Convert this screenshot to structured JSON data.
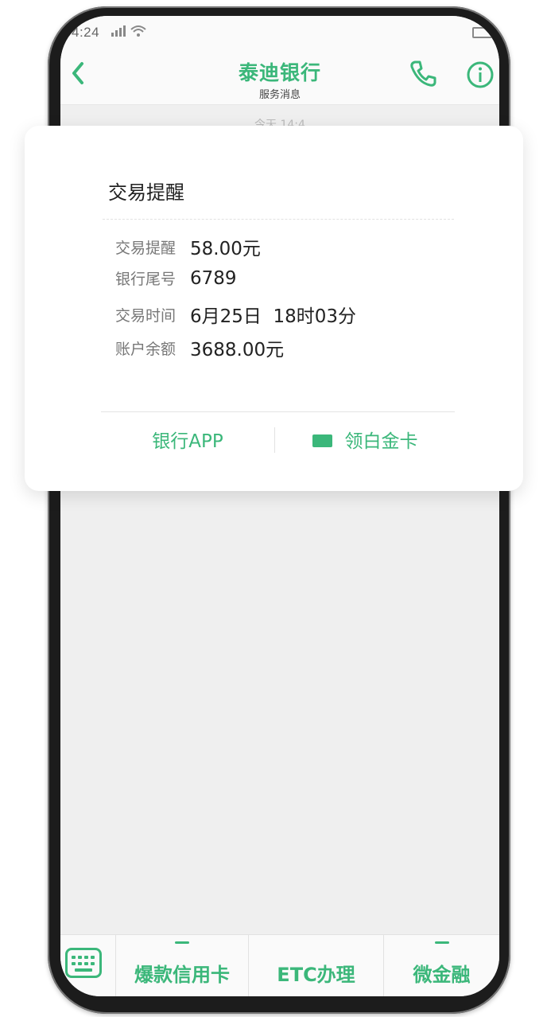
{
  "status_bar": {
    "time": "4:24"
  },
  "nav": {
    "title": "泰迪银行",
    "subtitle": "服务消息"
  },
  "date_divider": "今天 14:4",
  "notification": {
    "title": "交易提醒",
    "rows": [
      {
        "label": "交易提醒",
        "value": "58.00元"
      },
      {
        "label": "银行尾号",
        "value": "6789"
      },
      {
        "label": "交易时间",
        "value": "6月25日  18时03分"
      },
      {
        "label": "账户余额",
        "value": "3688.00元"
      }
    ],
    "actions": {
      "left": "银行APP",
      "right": "领白金卡"
    }
  },
  "bottom_menu": {
    "items": [
      {
        "label": "爆款信用卡"
      },
      {
        "label": "ETC办理"
      },
      {
        "label": "微金融"
      }
    ]
  },
  "colors": {
    "accent": "#3bb77a",
    "background": "#efefef"
  }
}
